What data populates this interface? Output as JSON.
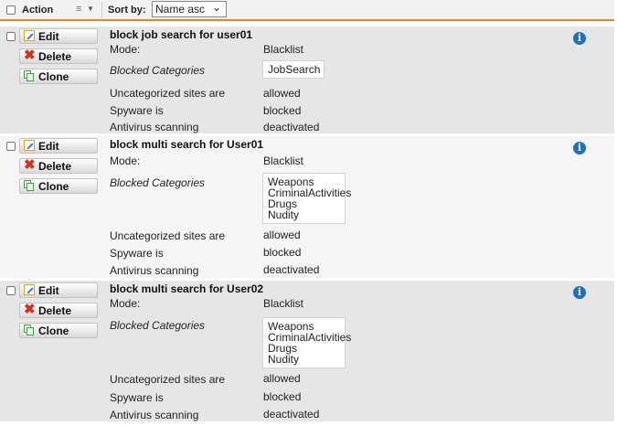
{
  "toolbar": {
    "action_label": "Action",
    "sort_label": "Sort by:",
    "sort_value": "Name asc"
  },
  "buttons": {
    "edit": "Edit",
    "delete": "Delete",
    "clone": "Clone"
  },
  "labels": {
    "mode": "Mode:",
    "blocked_categories": "Blocked Categories",
    "uncategorized": "Uncategorized sites are",
    "spyware": "Spyware is",
    "antivirus": "Antivirus scanning"
  },
  "rules": [
    {
      "name": "block job search for user01",
      "mode": "Blacklist",
      "categories": [
        "JobSearch"
      ],
      "uncategorized": "allowed",
      "spyware": "blocked",
      "antivirus": "deactivated"
    },
    {
      "name": "block multi search for User01",
      "mode": "Blacklist",
      "categories": [
        "Weapons",
        "CriminalActivities",
        "Drugs",
        "Nudity"
      ],
      "uncategorized": "allowed",
      "spyware": "blocked",
      "antivirus": "deactivated"
    },
    {
      "name": "block multi search for User02",
      "mode": "Blacklist",
      "categories": [
        "Weapons",
        "CriminalActivities",
        "Drugs",
        "Nudity"
      ],
      "uncategorized": "allowed",
      "spyware": "blocked",
      "antivirus": "deactivated"
    }
  ]
}
